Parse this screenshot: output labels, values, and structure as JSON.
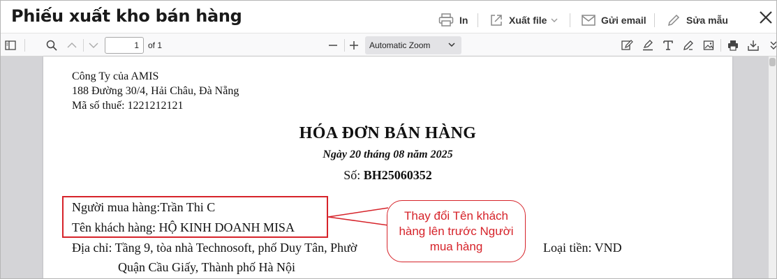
{
  "header": {
    "title": "Phiếu xuất kho bán hàng",
    "print_label": "In",
    "export_label": "Xuất file",
    "email_label": "Gửi email",
    "edit_template_label": "Sửa mẫu"
  },
  "pdf_toolbar": {
    "page_number": "1",
    "page_of": "of 1",
    "zoom": "Automatic Zoom"
  },
  "document": {
    "company_name": "Công Ty của AMIS",
    "company_address": "188 Đường 30/4, Hải Châu, Đà Nẵng",
    "tax_code": "Mã số thuế: 1221212121",
    "title": "HÓA ĐƠN BÁN HÀNG",
    "date": "Ngày 20 tháng 08 năm 2025",
    "number_label": "Số:",
    "number_value": "BH25060352",
    "buyer": "Người mua hàng:Trần Thi C",
    "customer": "Tên khách hàng: HỘ KINH DOANH MISA",
    "address_line1": "Địa chỉ: Tầng 9, tòa nhà Technosoft, phố Duy Tân, Phườ",
    "currency": "Loại tiền: VND",
    "address_line2": "Quận Cầu Giấy, Thành phố Hà Nội"
  },
  "annotation": {
    "callout_text": "Thay đổi Tên khách hàng lên trước Người mua hàng",
    "color": "#d6232a"
  }
}
